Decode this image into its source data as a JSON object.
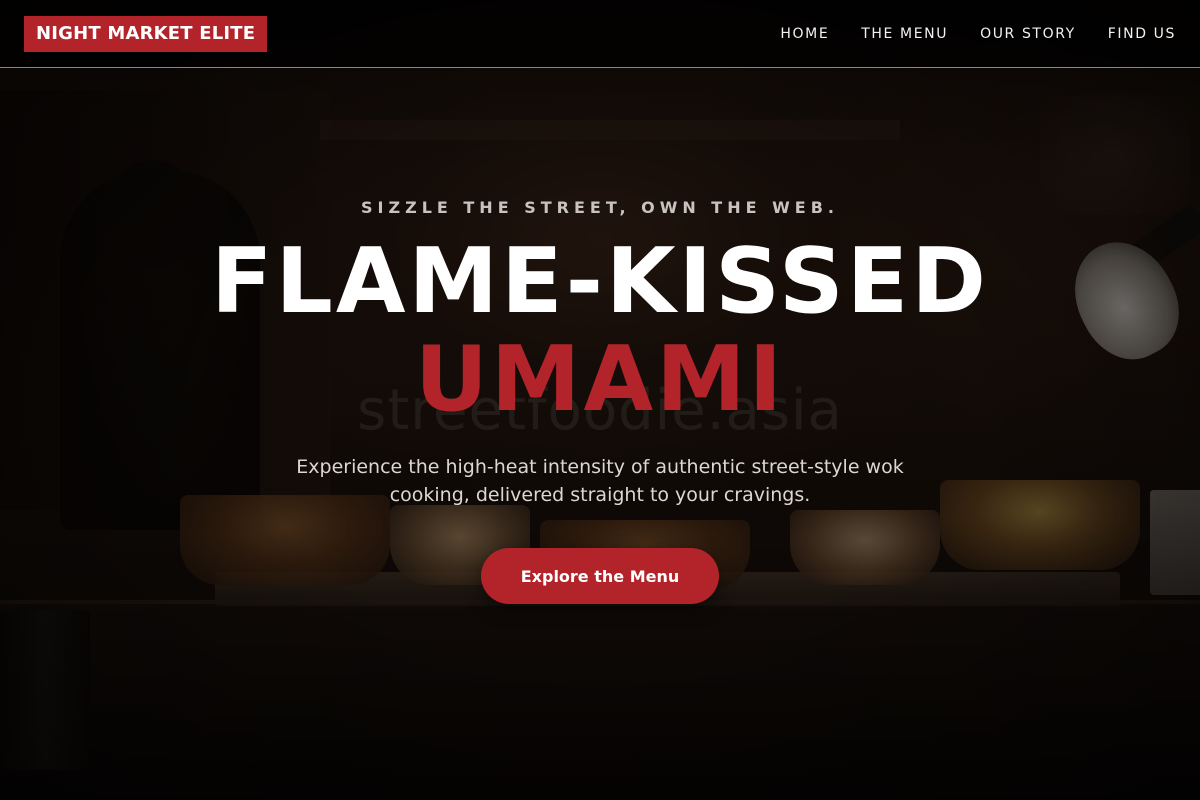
{
  "brand": {
    "name": "NIGHT MARKET ELITE",
    "accent_color": "#b3232a"
  },
  "nav": {
    "items": [
      {
        "label": "HOME"
      },
      {
        "label": "THE MENU"
      },
      {
        "label": "OUR STORY"
      },
      {
        "label": "FIND US"
      }
    ]
  },
  "hero": {
    "eyebrow": "SIZZLE THE STREET, OWN THE WEB.",
    "title_line1": "FLAME-KISSED",
    "title_line2": "UMAMI",
    "watermark": "streetfoodie.asia",
    "subtitle": "Experience the high-heat intensity of authentic street-style wok cooking, delivered straight to your cravings.",
    "cta_label": "Explore the Menu"
  }
}
